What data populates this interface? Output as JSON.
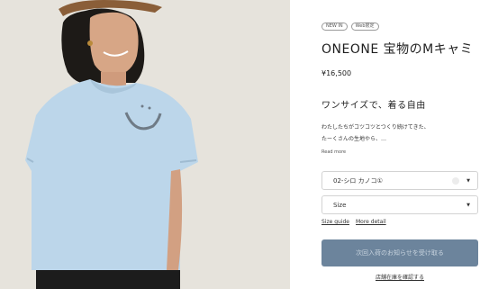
{
  "product": {
    "badges": [
      "NEW IN",
      "Web限定"
    ],
    "title": "ONEONE 宝物のMキャミ",
    "price": "¥16,500",
    "tagline": "ワンサイズで、着る自由",
    "description_lines": [
      "わたしたちがコツコツとつくり続けてきた、",
      "たーくさんの生地やら、…"
    ],
    "read_more": "Read more"
  },
  "options": {
    "color": {
      "label": "02-シロ カノコ①",
      "arrow": "▼"
    },
    "size": {
      "label": "Size",
      "arrow": "▼"
    }
  },
  "links": {
    "size_guide": "Size guide",
    "more_detail": "More detail",
    "store_stock": "店舗在庫を確認する"
  },
  "actions": {
    "notify": "次回入荷のお知らせを受け取る"
  },
  "colors": {
    "button": "#6c849c",
    "tshirt": "#bcd6ea",
    "background": "#e6e3dc"
  }
}
